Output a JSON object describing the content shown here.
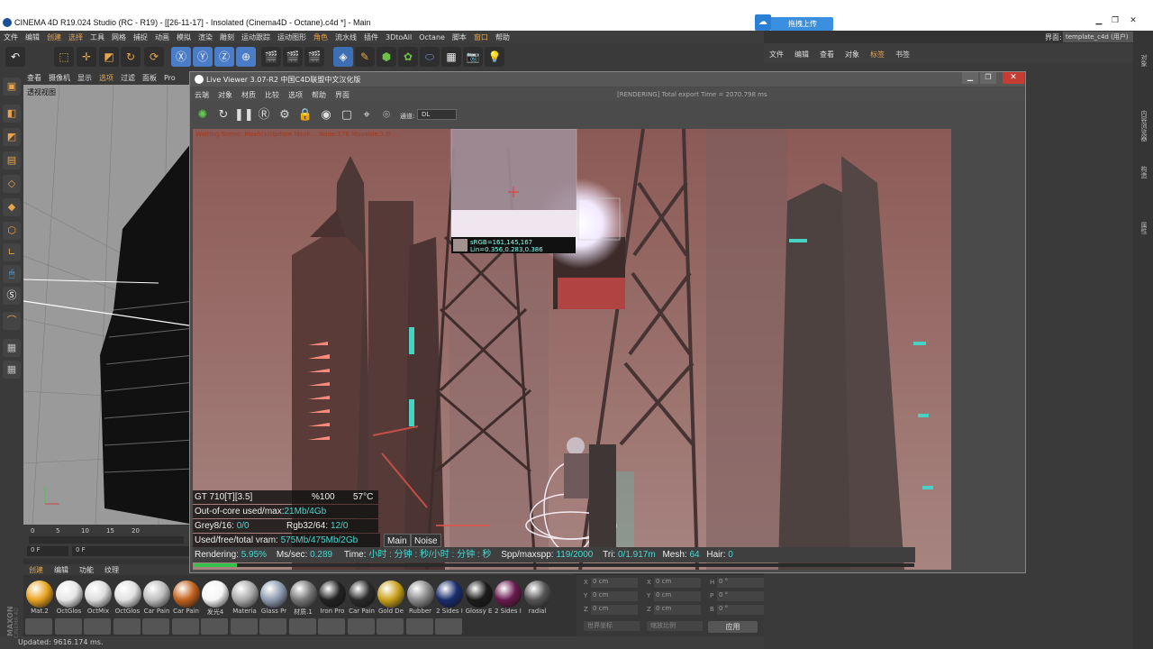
{
  "app": {
    "window_title": "CINEMA 4D R19.024 Studio (RC - R19) - [[26-11-17] - Insolated (Cinema4D - Octane).c4d *] - Main",
    "upload_button": "拖拽上传",
    "layout_label": "界面:",
    "layout_value": "template_c4d (用户)"
  },
  "menubar": [
    "文件",
    "编辑",
    "创建",
    "选择",
    "工具",
    "网格",
    "捕捉",
    "动画",
    "模拟",
    "渲染",
    "雕刻",
    "运动跟踪",
    "运动图形",
    "角色",
    "流水线",
    "插件",
    "3DtoAll",
    "Octane",
    "脚本",
    "窗口",
    "帮助"
  ],
  "viewport": {
    "menu": [
      "查看",
      "摄像机",
      "显示",
      "选项",
      "过滤",
      "面板",
      "Pro"
    ],
    "label": "透视视图"
  },
  "timeline": {
    "ticks": [
      "0",
      "5",
      "10",
      "15",
      "20"
    ],
    "frame_start": "0 F",
    "frame_current": "0 F"
  },
  "material_menu": [
    "创建",
    "编辑",
    "功能",
    "纹理"
  ],
  "materials": [
    {
      "label": "Mat.2",
      "color": "#e8a320"
    },
    {
      "label": "OctGlos",
      "color": "#e6e6e6"
    },
    {
      "label": "OctMix",
      "color": "#dddddd"
    },
    {
      "label": "OctGlos",
      "color": "#e0e0e0"
    },
    {
      "label": "Car Pain",
      "color": "#bdbdbd"
    },
    {
      "label": "Car Pain",
      "color": "#c2621e"
    },
    {
      "label": "发光4",
      "color": "#f5f5f5"
    },
    {
      "label": "Materia",
      "color": "#aaaaaa"
    },
    {
      "label": "Glass Pr",
      "color": "#8e9bb0"
    },
    {
      "label": "材质.1",
      "color": "#777777"
    },
    {
      "label": "Iron Pro",
      "color": "#222222"
    },
    {
      "label": "Car Pain",
      "color": "#2a2a2a"
    },
    {
      "label": "Gold De",
      "color": "#c9a11a"
    },
    {
      "label": "Rubber",
      "color": "#8a8a8a"
    },
    {
      "label": "2 Sides I",
      "color": "#1a2d6e"
    },
    {
      "label": "Glossy E",
      "color": "#1b1b1b"
    },
    {
      "label": "2 Sides I",
      "color": "#6b1a4e"
    },
    {
      "label": "radial",
      "color": "#555555"
    }
  ],
  "coords": {
    "rows": [
      [
        "X",
        "0 cm",
        "X",
        "0 cm",
        "H",
        "0 °"
      ],
      [
        "Y",
        "0 cm",
        "Y",
        "0 cm",
        "P",
        "0 °"
      ],
      [
        "Z",
        "0 cm",
        "Z",
        "0 cm",
        "B",
        "0 °"
      ]
    ],
    "world_select": "世界坐标",
    "scale_select": "缩放比例",
    "apply": "应用"
  },
  "status": "Updated: 9616.174 ms.",
  "right_panel": {
    "menu": [
      "文件",
      "编辑",
      "查看",
      "对象",
      "标签",
      "书签"
    ],
    "side_tabs": [
      "对象",
      "内容浏览器",
      "构造",
      "属性"
    ]
  },
  "live_viewer": {
    "title": "Live Viewer 3.07-R2 中国C4D联盟中文汉化版",
    "menu": [
      "云端",
      "对象",
      "材质",
      "比较",
      "选项",
      "帮助",
      "界面"
    ],
    "status": "[RENDERING] Total export Time = 2070.798 ms",
    "channel_label": "通道:",
    "channel_value": "DL",
    "render_message": "Waiting Scene: Mesh(s)Update Mesh... Node:176 Movable:1.0 ...",
    "pixel_srgb": "sRGB=161,145,167",
    "pixel_lin": "Lin=0.356,0.283,0.386",
    "hud": {
      "gpu": "GT 710[T][3.5]",
      "gpu_pct": "%100",
      "gpu_temp": "57°C",
      "ooc_label": "Out-of-core used/max:",
      "ooc_value": "21Mb/4Gb",
      "grey_label": "Grey8/16:",
      "grey_value": "0/0",
      "rgb_label": "Rgb32/64:",
      "rgb_value": "12/0",
      "vram_label": "Used/free/total vram:",
      "vram_value": "575Mb/475Mb/2Gb",
      "tab_main": "Main",
      "tab_noise": "Noise"
    },
    "stats": {
      "rendering_label": "Rendering:",
      "rendering_value": "5.95%",
      "ms_label": "Ms/sec:",
      "ms_value": "0.289",
      "time_label": "Time:",
      "time_value": "小时 : 分钟 : 秒/小时 : 分钟 : 秒",
      "spp_label": "Spp/maxspp:",
      "spp_value": "119/2000",
      "tri_label": "Tri:",
      "tri_value": "0/1.917m",
      "mesh_label": "Mesh:",
      "mesh_value": "64",
      "hair_label": "Hair:",
      "hair_value": "0"
    },
    "progress": 0.0595
  }
}
